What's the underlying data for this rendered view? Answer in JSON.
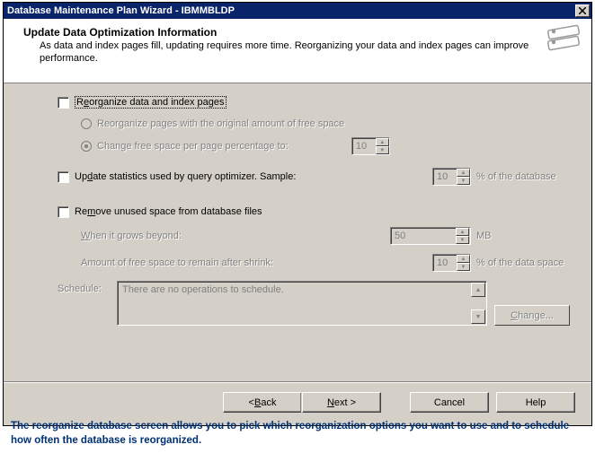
{
  "titlebar": {
    "text": "Database Maintenance Plan Wizard - IBMMBLDP"
  },
  "header": {
    "title": "Update Data Optimization Information",
    "desc": "As data and index pages fill, updating requires more time. Reorganizing your data and index pages can improve performance."
  },
  "reorganize": {
    "prefix": "R",
    "mnemonic": "e",
    "suffix": "organize data and index pages",
    "opt1": "Reorganize pages with the original amount of free space",
    "opt2": "Change free space per page percentage to:",
    "pct": "10"
  },
  "updatestats": {
    "prefix": "Up",
    "mnemonic": "d",
    "suffix": "ate statistics used by query optimizer. Sample:",
    "pct": "10",
    "suffix_label": "% of the database"
  },
  "removespace": {
    "prefix": "Re",
    "mnemonic": "m",
    "suffix": "ove unused space from database files",
    "grows_prefix": "",
    "grows_mnemonic": "W",
    "grows_suffix": "hen it grows beyond:",
    "grows_val": "50",
    "grows_unit": "MB",
    "remain_label": "Amount of free space to remain after shrink:",
    "remain_val": "10",
    "remain_suffix": "% of the data space"
  },
  "schedule": {
    "label": "Schedule:",
    "text": "There are no operations to schedule.",
    "change_prefix": "",
    "change_mnemonic": "C",
    "change_suffix": "hange..."
  },
  "buttons": {
    "back_prefix": "< ",
    "back_mnemonic": "B",
    "back_suffix": "ack",
    "next_prefix": "",
    "next_mnemonic": "N",
    "next_suffix": "ext >",
    "cancel": "Cancel",
    "help": "Help"
  },
  "caption": "The reorganize database screen  allows you to pick which reorganization options you want to use and to schedule how often the database is reorganized."
}
